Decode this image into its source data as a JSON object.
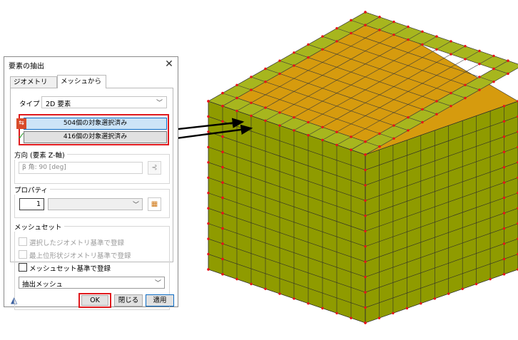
{
  "dialog": {
    "title": "要素の抽出",
    "close_glyph": "✕",
    "tabs": [
      {
        "label": "ジオメトリから",
        "active": false
      },
      {
        "label": "メッシュから",
        "active": true
      }
    ],
    "type_label": "タイプ",
    "type_value": "2D 要素",
    "selection": {
      "first": "504個の対象選択済み",
      "second": "416個の対象選択済み"
    },
    "direction": {
      "group_title": "方向 (要素 Z-軸)",
      "angle_placeholder": "β 角: 90 [deg]"
    },
    "property": {
      "group_title": "プロパティ",
      "number": "1",
      "selected": ""
    },
    "meshset": {
      "group_title": "メッシュセット",
      "options": [
        {
          "label": "選択したジオメトリ基準で登録",
          "enabled": false,
          "checked": false
        },
        {
          "label": "最上位形状ジオメトリ基準で登録",
          "enabled": false,
          "checked": false
        },
        {
          "label": "メッシュセット基準で登録",
          "enabled": true,
          "checked": false
        }
      ],
      "name_value": "抽出メッシュ"
    },
    "buttons": {
      "ok": "OK",
      "close": "閉じる",
      "apply": "適用"
    }
  },
  "colors": {
    "highlight_red": "#e0191d",
    "top_face": "#d69b0e",
    "side_face": "#8f9b00",
    "edge_strip": "#a7b61e",
    "node": "#e8121a"
  },
  "icons": [
    "close-icon",
    "selection-red-icon",
    "check-icon",
    "vector-icon",
    "property-icon",
    "eraser-icon",
    "chevron-down-icon"
  ]
}
